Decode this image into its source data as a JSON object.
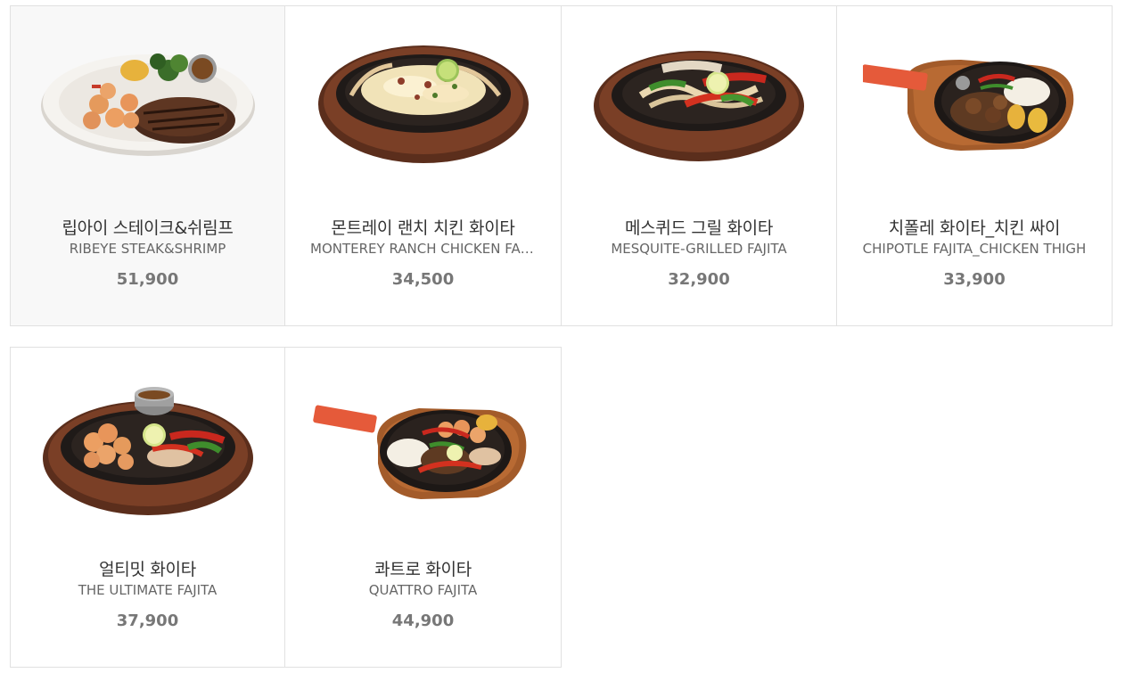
{
  "menu": {
    "items": [
      {
        "name_kr": "립아이 스테이크&쉬림프",
        "name_en": "RIBEYE STEAK&SHRIMP",
        "price": "51,900",
        "image": "plate-steak-shrimp-image"
      },
      {
        "name_kr": "몬트레이 랜치 치킨 화이타",
        "name_en": "MONTEREY RANCH CHICKEN FAJITA",
        "price": "34,500",
        "image": "skillet-ranch-chicken-image"
      },
      {
        "name_kr": "메스퀴드 그릴 화이타",
        "name_en": "MESQUITE-GRILLED FAJITA",
        "price": "32,900",
        "image": "skillet-peppers-image"
      },
      {
        "name_kr": "치폴레 화이타_치킨 싸이",
        "name_en": "CHIPOTLE FAJITA_CHICKEN THIGH",
        "price": "33,900",
        "image": "pan-chicken-thigh-image"
      },
      {
        "name_kr": "얼티밋 화이타",
        "name_en": "THE ULTIMATE FAJITA",
        "price": "37,900",
        "image": "skillet-shrimp-image"
      },
      {
        "name_kr": "콰트로 화이타",
        "name_en": "QUATTRO FAJITA",
        "price": "44,900",
        "image": "pan-quattro-image"
      }
    ]
  },
  "colors": {
    "border": "#e1e1e1",
    "hover_bg": "#f8f8f8",
    "title": "#333333",
    "subtitle": "#666666",
    "price": "#777777"
  }
}
